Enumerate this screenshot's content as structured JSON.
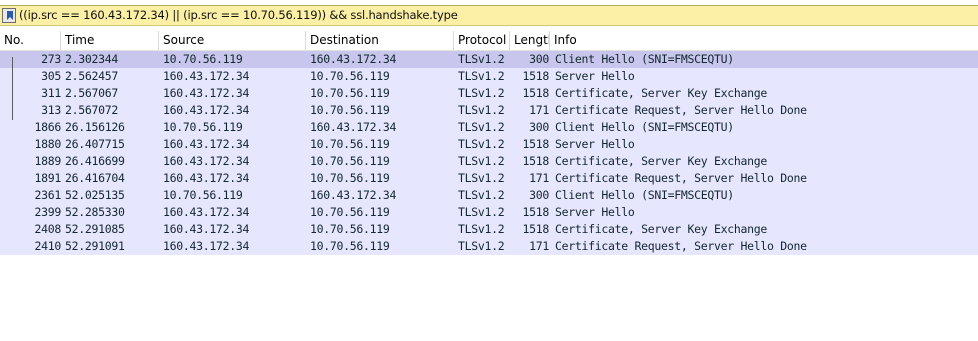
{
  "filter": {
    "text": "((ip.src == 160.43.172.34) || (ip.src == 10.70.56.119)) && ssl.handshake.type"
  },
  "columns": {
    "no": "No.",
    "time": "Time",
    "source": "Source",
    "destination": "Destination",
    "protocol": "Protocol",
    "length": "Length",
    "info": "Info"
  },
  "packets": [
    {
      "no": "273",
      "time": "2.302344",
      "source": "10.70.56.119",
      "destination": "160.43.172.34",
      "protocol": "TLSv1.2",
      "length": "300",
      "info": "Client Hello (SNI=FMSCEQTU)"
    },
    {
      "no": "305",
      "time": "2.562457",
      "source": "160.43.172.34",
      "destination": "10.70.56.119",
      "protocol": "TLSv1.2",
      "length": "1518",
      "info": "Server Hello"
    },
    {
      "no": "311",
      "time": "2.567067",
      "source": "160.43.172.34",
      "destination": "10.70.56.119",
      "protocol": "TLSv1.2",
      "length": "1518",
      "info": "Certificate, Server Key Exchange"
    },
    {
      "no": "313",
      "time": "2.567072",
      "source": "160.43.172.34",
      "destination": "10.70.56.119",
      "protocol": "TLSv1.2",
      "length": "171",
      "info": "Certificate Request, Server Hello Done"
    },
    {
      "no": "1866",
      "time": "26.156126",
      "source": "10.70.56.119",
      "destination": "160.43.172.34",
      "protocol": "TLSv1.2",
      "length": "300",
      "info": "Client Hello (SNI=FMSCEQTU)"
    },
    {
      "no": "1880",
      "time": "26.407715",
      "source": "160.43.172.34",
      "destination": "10.70.56.119",
      "protocol": "TLSv1.2",
      "length": "1518",
      "info": "Server Hello"
    },
    {
      "no": "1889",
      "time": "26.416699",
      "source": "160.43.172.34",
      "destination": "10.70.56.119",
      "protocol": "TLSv1.2",
      "length": "1518",
      "info": "Certificate, Server Key Exchange"
    },
    {
      "no": "1891",
      "time": "26.416704",
      "source": "160.43.172.34",
      "destination": "10.70.56.119",
      "protocol": "TLSv1.2",
      "length": "171",
      "info": "Certificate Request, Server Hello Done"
    },
    {
      "no": "2361",
      "time": "52.025135",
      "source": "10.70.56.119",
      "destination": "160.43.172.34",
      "protocol": "TLSv1.2",
      "length": "300",
      "info": "Client Hello (SNI=FMSCEQTU)"
    },
    {
      "no": "2399",
      "time": "52.285330",
      "source": "160.43.172.34",
      "destination": "10.70.56.119",
      "protocol": "TLSv1.2",
      "length": "1518",
      "info": "Server Hello"
    },
    {
      "no": "2408",
      "time": "52.291085",
      "source": "160.43.172.34",
      "destination": "10.70.56.119",
      "protocol": "TLSv1.2",
      "length": "1518",
      "info": "Certificate, Server Key Exchange"
    },
    {
      "no": "2410",
      "time": "52.291091",
      "source": "160.43.172.34",
      "destination": "10.70.56.119",
      "protocol": "TLSv1.2",
      "length": "171",
      "info": "Certificate Request, Server Hello Done"
    }
  ],
  "selected_packet": "273",
  "colors": {
    "filter_bg": "#fbf0a5",
    "row_bg": "#e7e6ff",
    "selected_row_bg": "#c8c6ec"
  }
}
